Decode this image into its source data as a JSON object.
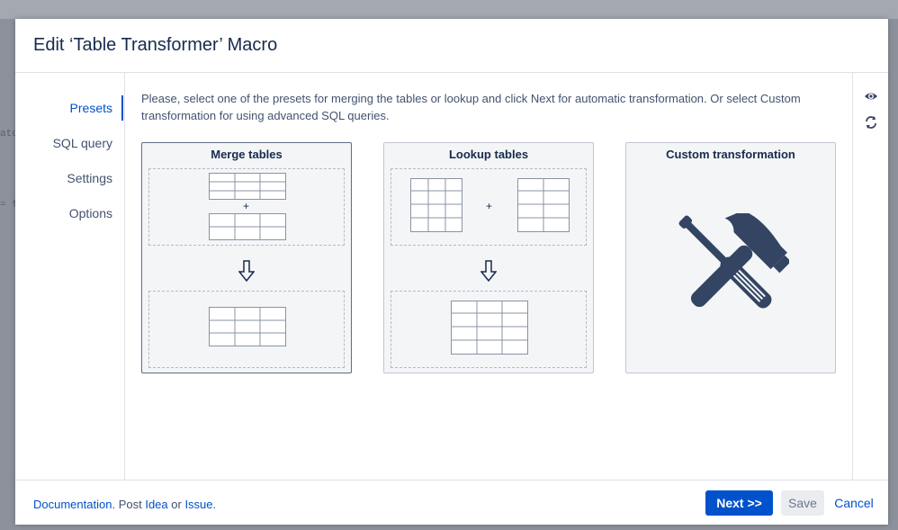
{
  "background": {
    "fragments": [
      "ator",
      "= fa"
    ]
  },
  "dialog": {
    "title": "Edit ‘Table Transformer’ Macro",
    "nav": {
      "items": [
        {
          "label": "Presets",
          "active": true
        },
        {
          "label": "SQL query",
          "active": false
        },
        {
          "label": "Settings",
          "active": false
        },
        {
          "label": "Options",
          "active": false
        }
      ]
    },
    "intro_text": "Please, select one of the presets for merging the tables or lookup and click Next for automatic transformation. Or select Custom transformation for using advanced SQL queries.",
    "presets": [
      {
        "title": "Merge tables",
        "selected": true,
        "plus": "+"
      },
      {
        "title": "Lookup tables",
        "selected": false,
        "plus": "+"
      },
      {
        "title": "Custom transformation",
        "selected": false,
        "icon": "hammer-screwdriver-icon"
      }
    ],
    "rail_icons": [
      "eye-icon",
      "refresh-icon"
    ],
    "footer": {
      "documentation": "Documentation",
      "dot": ".",
      "post": " Post ",
      "idea": "Idea",
      "or": " or ",
      "issue": "Issue",
      "end": "."
    },
    "buttons": {
      "next": "Next >>",
      "save": "Save",
      "cancel": "Cancel"
    }
  },
  "colors": {
    "accent": "#0052cc",
    "text": "#172b4d",
    "muted": "#42526e",
    "overlay": "#8d919c",
    "icon_fill": "#344563"
  }
}
